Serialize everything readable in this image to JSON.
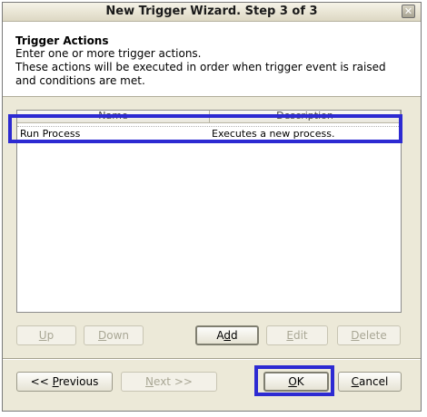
{
  "window": {
    "title": "New Trigger Wizard. Step 3 of 3"
  },
  "header": {
    "title": "Trigger Actions",
    "line1": "Enter one or more trigger actions.",
    "line2": "These actions will be executed in order when trigger event is raised",
    "line3": "and conditions are met."
  },
  "table": {
    "columns": [
      "Name",
      "Description"
    ],
    "rows": [
      {
        "name": "Run Process",
        "description": "Executes a new process."
      }
    ]
  },
  "actions": {
    "up": {
      "mnemonic": "U",
      "rest": "p"
    },
    "down": {
      "mnemonic": "D",
      "rest": "own"
    },
    "add": {
      "pre": "A",
      "mnemonic": "d",
      "rest": "d"
    },
    "edit": {
      "mnemonic": "E",
      "rest": "dit"
    },
    "delete": {
      "mnemonic": "D",
      "rest": "elete"
    }
  },
  "nav": {
    "previous": {
      "pre": "<< ",
      "mnemonic": "P",
      "rest": "revious"
    },
    "next": {
      "mnemonic": "N",
      "rest": "ext >>"
    },
    "ok": {
      "mnemonic": "O",
      "rest": "K"
    },
    "cancel": {
      "mnemonic": "C",
      "rest": "ancel"
    }
  },
  "colors": {
    "highlight": "#2d2ad2",
    "dialog_bg": "#ece9d8"
  },
  "icons": {
    "close": "close-icon"
  }
}
